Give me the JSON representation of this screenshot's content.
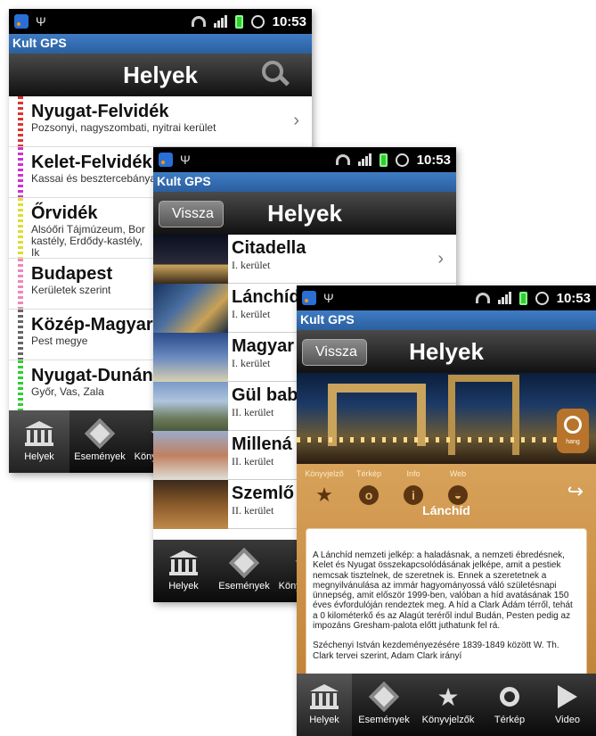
{
  "status_bar": {
    "time": "10:53"
  },
  "app_name": "Kult GPS",
  "screen1": {
    "title": "Helyek",
    "regions": [
      {
        "name": "Nyugat-Felvidék",
        "sub": "Pozsonyi, nagyszombati, nyitrai kerület",
        "color": "#d33"
      },
      {
        "name": "Kelet-Felvidék",
        "sub": "Kassai és besztercebánya",
        "color": "#c3c"
      },
      {
        "name": "Őrvidék",
        "sub": "Alsóőri Tájmúzeum, Bor kastély, Erdődy-kastély, Ik",
        "color": "#dd3"
      },
      {
        "name": "Budapest",
        "sub": "Kerületek szerint",
        "color": "#e8b"
      },
      {
        "name": "Közép-Magyar",
        "sub": "Pest megye",
        "color": "#666"
      },
      {
        "name": "Nyugat-Dunán",
        "sub": "Győr, Vas, Zala",
        "color": "#3c3"
      }
    ],
    "tabs": [
      "Helyek",
      "Események",
      "Könyvjelzők"
    ]
  },
  "screen2": {
    "back": "Vissza",
    "title": "Helyek",
    "places": [
      {
        "name": "Citadella",
        "sub": "I. kerület"
      },
      {
        "name": "Lánchíd",
        "sub": "I. kerület"
      },
      {
        "name": "Magyar",
        "sub": "I. kerület"
      },
      {
        "name": "Gül bab",
        "sub": "II. kerület"
      },
      {
        "name": "Millená",
        "sub": "II. kerület"
      },
      {
        "name": "Szemlő",
        "sub": "II. kerület"
      }
    ],
    "tabs": [
      "Helyek",
      "Események",
      "Könyvjelzők"
    ]
  },
  "screen3": {
    "back": "Vissza",
    "title": "Helyek",
    "audio_label": "hang",
    "actions": [
      "Könyvjelző",
      "Térkép",
      "Info",
      "Web"
    ],
    "heading": "Lánchíd",
    "text_p1": "A Lánchíd nemzeti jelkép: a haladásnak, a nemzeti ébredésnek, Kelet és Nyugat összekapcsolódásának jelképe, amit a pestiek nemcsak tisztelnek, de szeretnek is. Ennek a szeretetnek a megnyilvánulása az immár hagyományossá váló születésnapi ünnepség, amit először 1999-ben, valóban a híd avatásának 150 éves évfordulóján rendeztek meg. A híd a Clark Ádám térről, tehát a 0 kilométerkő és az Alagút teréről indul Budán, Pesten pedig az impozáns Gresham-palota előtt juthatunk fel rá.",
    "text_p2": "Széchenyi István kezdeményezésére 1839-1849 között W. Th. Clark tervei szerint, Adam Clark irányí",
    "tabs": [
      "Helyek",
      "Események",
      "Könyvjelzők",
      "Térkép",
      "Video"
    ]
  }
}
